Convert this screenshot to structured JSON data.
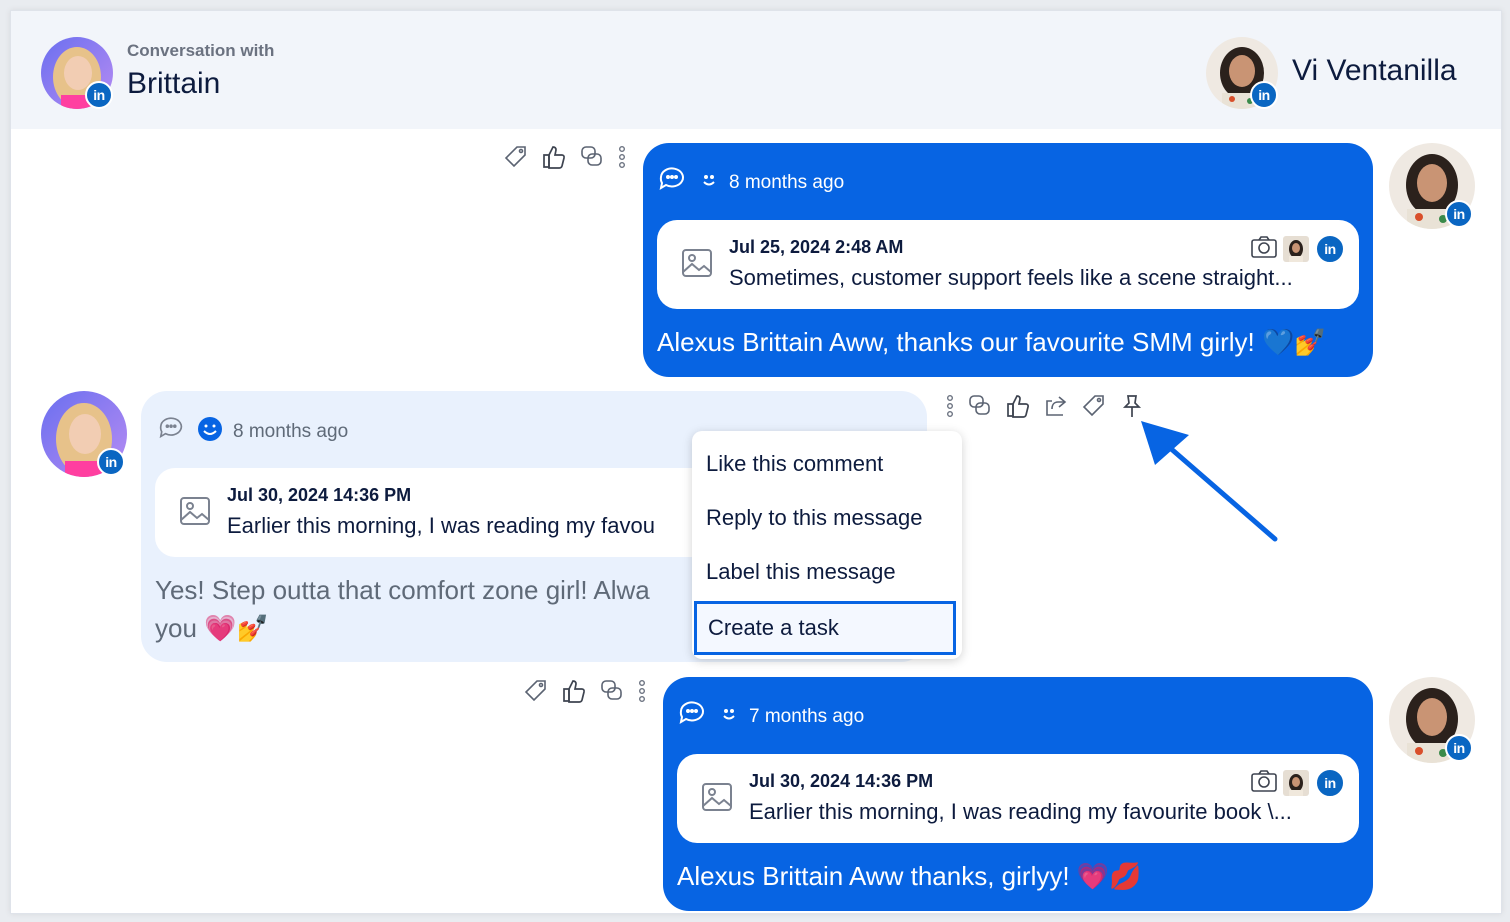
{
  "header": {
    "conversation_with_label": "Conversation with",
    "contact_name": "Brittain",
    "account_name": "Vi Ventanilla",
    "network_badge": "in"
  },
  "messages": [
    {
      "time": "8 months ago",
      "quote_date": "Jul 25, 2024 2:48 AM",
      "quote_text": "Sometimes, customer support feels like a scene straight...",
      "text": "Alexus Brittain Aww, thanks our favourite SMM girly! 💙💅"
    },
    {
      "time": "8 months ago",
      "quote_date": "Jul 30, 2024 14:36 PM",
      "quote_text": "Earlier this morning, I was reading my favou",
      "text_line1": "Yes! Step outta that comfort zone girl! Alwa",
      "text_line2": "you 💗💅"
    },
    {
      "time": "7 months ago",
      "quote_date": "Jul 30, 2024 14:36 PM",
      "quote_text": "Earlier this morning, I was reading my favourite book \\...",
      "text": "Alexus Brittain Aww thanks, girlyy! 💗💋"
    }
  ],
  "context_menu": {
    "items": [
      "Like this comment",
      "Reply to this message",
      "Label this message",
      "Create a task"
    ],
    "active_index": 3
  },
  "colors": {
    "accent_blue": "#0764e3",
    "linkedin_blue": "#0a66c2",
    "light_bubble": "#e9f1fd",
    "header_bg": "#f2f5fa"
  },
  "icons": [
    "tag-icon",
    "thumbs-up-icon",
    "chat-bubbles-icon",
    "more-dots-icon",
    "share-icon",
    "pin-icon",
    "camera-icon",
    "image-icon",
    "smiley-icon",
    "comments-icon"
  ]
}
